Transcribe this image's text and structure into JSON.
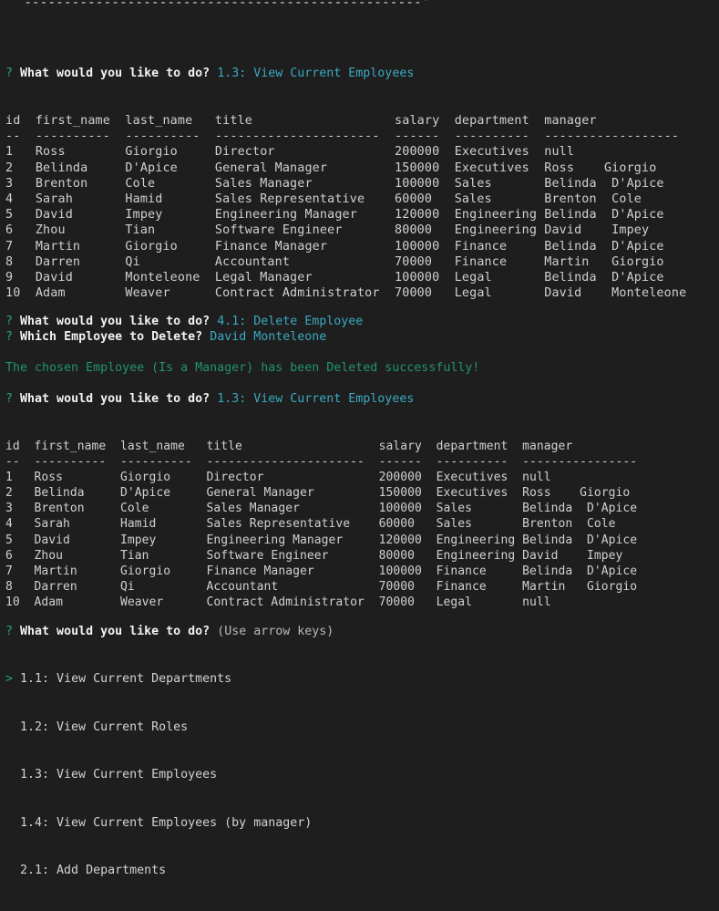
{
  "terminal": {
    "background": "#1e1e1e",
    "prompt_marker": "?",
    "pointer_marker": ">",
    "colors": {
      "green": "#2aa36b",
      "cyan": "#3aa9bf",
      "white": "#f2f2f2",
      "grey": "#cdcdcd",
      "success_green": "#21946b"
    }
  },
  "banner": {
    "line1": "  |                                                  |",
    "line2": "  `--------------------------------------------------'"
  },
  "prompt1": {
    "marker": "?",
    "question": "What would you like to do?",
    "answer": "1.3: View Current Employees"
  },
  "table1": {
    "headers": [
      "id",
      "first_name",
      "last_name",
      "title",
      "salary",
      "department",
      "manager"
    ],
    "header_line": "id  first_name  last_name  title                   salary  department  manager",
    "separator_line": "--  ----------  ---------  ----------------------  ------  ----------  ------------------",
    "rows": [
      {
        "id": "1",
        "first_name": "Ross",
        "last_name": "Giorgio",
        "title": "Director",
        "salary": "200000",
        "department": "Executives",
        "manager": "null"
      },
      {
        "id": "2",
        "first_name": "Belinda",
        "last_name": "D'Apice",
        "title": "General Manager",
        "salary": "150000",
        "department": "Executives",
        "manager": "Ross    Giorgio"
      },
      {
        "id": "3",
        "first_name": "Brenton",
        "last_name": "Cole",
        "title": "Sales Manager",
        "salary": "100000",
        "department": "Sales",
        "manager": "Belinda  D'Apice"
      },
      {
        "id": "4",
        "first_name": "Sarah",
        "last_name": "Hamid",
        "title": "Sales Representative",
        "salary": "60000",
        "department": "Sales",
        "manager": "Brenton  Cole"
      },
      {
        "id": "5",
        "first_name": "David",
        "last_name": "Impey",
        "title": "Engineering Manager",
        "salary": "120000",
        "department": "Engineering",
        "manager": "Belinda  D'Apice"
      },
      {
        "id": "6",
        "first_name": "Zhou",
        "last_name": "Tian",
        "title": "Software Engineer",
        "salary": "80000",
        "department": "Engineering",
        "manager": "David    Impey"
      },
      {
        "id": "7",
        "first_name": "Martin",
        "last_name": "Giorgio",
        "title": "Finance Manager",
        "salary": "100000",
        "department": "Finance",
        "manager": "Belinda  D'Apice"
      },
      {
        "id": "8",
        "first_name": "Darren",
        "last_name": "Qi",
        "title": "Accountant",
        "salary": "70000",
        "department": "Finance",
        "manager": "Martin   Giorgio"
      },
      {
        "id": "9",
        "first_name": "David",
        "last_name": "Monteleone",
        "title": "Legal Manager",
        "salary": "100000",
        "department": "Legal",
        "manager": "Belinda  D'Apice"
      },
      {
        "id": "10",
        "first_name": "Adam",
        "last_name": "Weaver",
        "title": "Contract Administrator",
        "salary": "70000",
        "department": "Legal",
        "manager": "David    Monteleone"
      }
    ],
    "text": "id  first_name  last_name   title                   salary  department  manager\n--  ----------  ----------  ----------------------  ------  ----------  ------------------\n1   Ross        Giorgio     Director                200000  Executives  null\n2   Belinda     D'Apice     General Manager         150000  Executives  Ross    Giorgio\n3   Brenton     Cole        Sales Manager           100000  Sales       Belinda  D'Apice\n4   Sarah       Hamid       Sales Representative    60000   Sales       Brenton  Cole\n5   David       Impey       Engineering Manager     120000  Engineering Belinda  D'Apice\n6   Zhou        Tian        Software Engineer       80000   Engineering David    Impey\n7   Martin      Giorgio     Finance Manager         100000  Finance     Belinda  D'Apice\n8   Darren      Qi          Accountant              70000   Finance     Martin   Giorgio\n9   David       Monteleone  Legal Manager           100000  Legal       Belinda  D'Apice\n10  Adam        Weaver      Contract Administrator  70000   Legal       David    Monteleone"
  },
  "prompt2": {
    "marker": "?",
    "question": "What would you like to do?",
    "answer": "4.1: Delete Employee"
  },
  "prompt3": {
    "marker": "?",
    "question": "Which Employee to Delete?",
    "answer": "David Monteleone"
  },
  "success_message": "The chosen Employee (Is a Manager) has been Deleted successfully!",
  "prompt4": {
    "marker": "?",
    "question": "What would you like to do?",
    "answer": "1.3: View Current Employees"
  },
  "table2": {
    "headers": [
      "id",
      "first_name",
      "last_name",
      "title",
      "salary",
      "department",
      "manager"
    ],
    "rows": [
      {
        "id": "1",
        "first_name": "Ross",
        "last_name": "Giorgio",
        "title": "Director",
        "salary": "200000",
        "department": "Executives",
        "manager": "null"
      },
      {
        "id": "2",
        "first_name": "Belinda",
        "last_name": "D'Apice",
        "title": "General Manager",
        "salary": "150000",
        "department": "Executives",
        "manager": "Ross    Giorgio"
      },
      {
        "id": "3",
        "first_name": "Brenton",
        "last_name": "Cole",
        "title": "Sales Manager",
        "salary": "100000",
        "department": "Sales",
        "manager": "Belinda  D'Apice"
      },
      {
        "id": "4",
        "first_name": "Sarah",
        "last_name": "Hamid",
        "title": "Sales Representative",
        "salary": "60000",
        "department": "Sales",
        "manager": "Brenton  Cole"
      },
      {
        "id": "5",
        "first_name": "David",
        "last_name": "Impey",
        "title": "Engineering Manager",
        "salary": "120000",
        "department": "Engineering",
        "manager": "Belinda  D'Apice"
      },
      {
        "id": "6",
        "first_name": "Zhou",
        "last_name": "Tian",
        "title": "Software Engineer",
        "salary": "80000",
        "department": "Engineering",
        "manager": "David    Impey"
      },
      {
        "id": "7",
        "first_name": "Martin",
        "last_name": "Giorgio",
        "title": "Finance Manager",
        "salary": "100000",
        "department": "Finance",
        "manager": "Belinda  D'Apice"
      },
      {
        "id": "8",
        "first_name": "Darren",
        "last_name": "Qi",
        "title": "Accountant",
        "salary": "70000",
        "department": "Finance",
        "manager": "Martin   Giorgio"
      },
      {
        "id": "10",
        "first_name": "Adam",
        "last_name": "Weaver",
        "title": "Contract Administrator",
        "salary": "70000",
        "department": "Legal",
        "manager": "null"
      }
    ],
    "text": "id  first_name  last_name   title                   salary  department  manager\n--  ----------  ----------  ----------------------  ------  ----------  ----------------\n1   Ross        Giorgio     Director                200000  Executives  null\n2   Belinda     D'Apice     General Manager         150000  Executives  Ross    Giorgio\n3   Brenton     Cole        Sales Manager           100000  Sales       Belinda  D'Apice\n4   Sarah       Hamid       Sales Representative    60000   Sales       Brenton  Cole\n5   David       Impey       Engineering Manager     120000  Engineering Belinda  D'Apice\n6   Zhou        Tian        Software Engineer       80000   Engineering David    Impey\n7   Martin      Giorgio     Finance Manager         100000  Finance     Belinda  D'Apice\n8   Darren      Qi          Accountant              70000   Finance     Martin   Giorgio\n10  Adam        Weaver      Contract Administrator  70000   Legal       null"
  },
  "prompt5": {
    "marker": "?",
    "question": "What would you like to do?",
    "hint": "(Use arrow keys)"
  },
  "menu": {
    "pointer": ">",
    "items": [
      {
        "label": "1.1: View Current Departments",
        "selected": true
      },
      {
        "label": "1.2: View Current Roles",
        "selected": false
      },
      {
        "label": "1.3: View Current Employees",
        "selected": false
      },
      {
        "label": "1.4: View Current Employees (by manager)",
        "selected": false
      },
      {
        "label": "2.1: Add Departments",
        "selected": false
      }
    ]
  }
}
